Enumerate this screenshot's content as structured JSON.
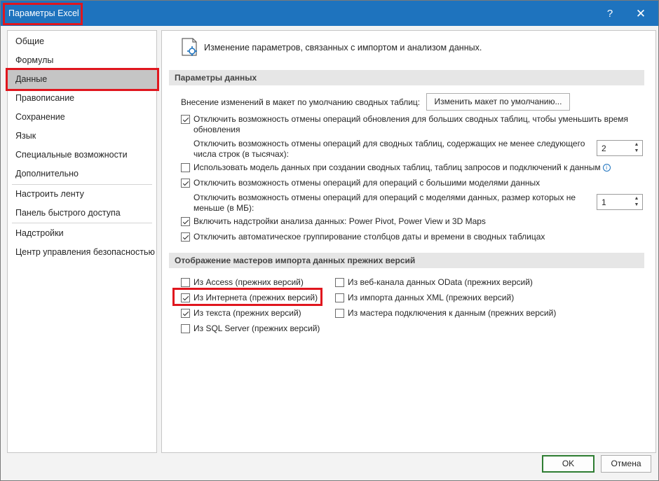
{
  "window": {
    "title": "Параметры Excel",
    "help_glyph": "?",
    "close_glyph": "✕"
  },
  "nav": {
    "selected_index": 2,
    "groups": [
      [
        "Общие",
        "Формулы",
        "Данные",
        "Правописание",
        "Сохранение",
        "Язык",
        "Специальные возможности",
        "Дополнительно"
      ],
      [
        "Настроить ленту",
        "Панель быстрого доступа"
      ],
      [
        "Надстройки",
        "Центр управления безопасностью"
      ]
    ]
  },
  "header": {
    "icon": "data-import-settings-icon",
    "text": "Изменение параметров, связанных с импортом и анализом данных."
  },
  "data_options": {
    "section_title": "Параметры данных",
    "default_layout_label": "Внесение изменений в макет по умолчанию сводных таблиц:",
    "default_layout_button": "Изменить макет по умолчанию...",
    "disable_undo_large_pivot": {
      "checked": true,
      "label": "Отключить возможность отмены операций обновления для больших сводных таблиц, чтобы уменьшить время обновления"
    },
    "pivot_rows_threshold_label": "Отключить возможность отмены операций для сводных таблиц, содержащих не менее следующего числа строк (в тысячах):",
    "pivot_rows_threshold_value": "2",
    "use_data_model": {
      "checked": false,
      "label": "Использовать модель данных при создании сводных таблиц, таблиц запросов и подключений к данным"
    },
    "disable_undo_large_model": {
      "checked": true,
      "label": "Отключить возможность отмены операций для операций с большими моделями данных"
    },
    "model_size_threshold_label": "Отключить возможность отмены операций для операций с моделями данных, размер которых не меньше (в МБ):",
    "model_size_threshold_value": "1",
    "enable_addins": {
      "checked": true,
      "label": "Включить надстройки анализа данных: Power Pivot, Power View и 3D Maps"
    },
    "disable_auto_grouping": {
      "checked": true,
      "label": "Отключить автоматическое группирование столбцов даты и времени в сводных таблицах"
    }
  },
  "legacy_wizards": {
    "section_title": "Отображение мастеров импорта данных прежних версий",
    "left": [
      {
        "checked": false,
        "label": "Из Access (прежних версий)"
      },
      {
        "checked": true,
        "label": "Из Интернета (прежних версий)"
      },
      {
        "checked": true,
        "label": "Из текста (прежних версий)"
      },
      {
        "checked": false,
        "label": "Из SQL Server (прежних версий)"
      }
    ],
    "right": [
      {
        "checked": false,
        "label": "Из веб-канала данных OData (прежних версий)"
      },
      {
        "checked": false,
        "label": "Из импорта данных XML (прежних версий)"
      },
      {
        "checked": false,
        "label": "Из мастера подключения к данным (прежних версий)"
      }
    ]
  },
  "footer": {
    "ok": "OK",
    "cancel": "Отмена"
  },
  "colors": {
    "titlebar": "#1e73be",
    "highlight": "#e0161e",
    "ok_border": "#2e7d32"
  }
}
